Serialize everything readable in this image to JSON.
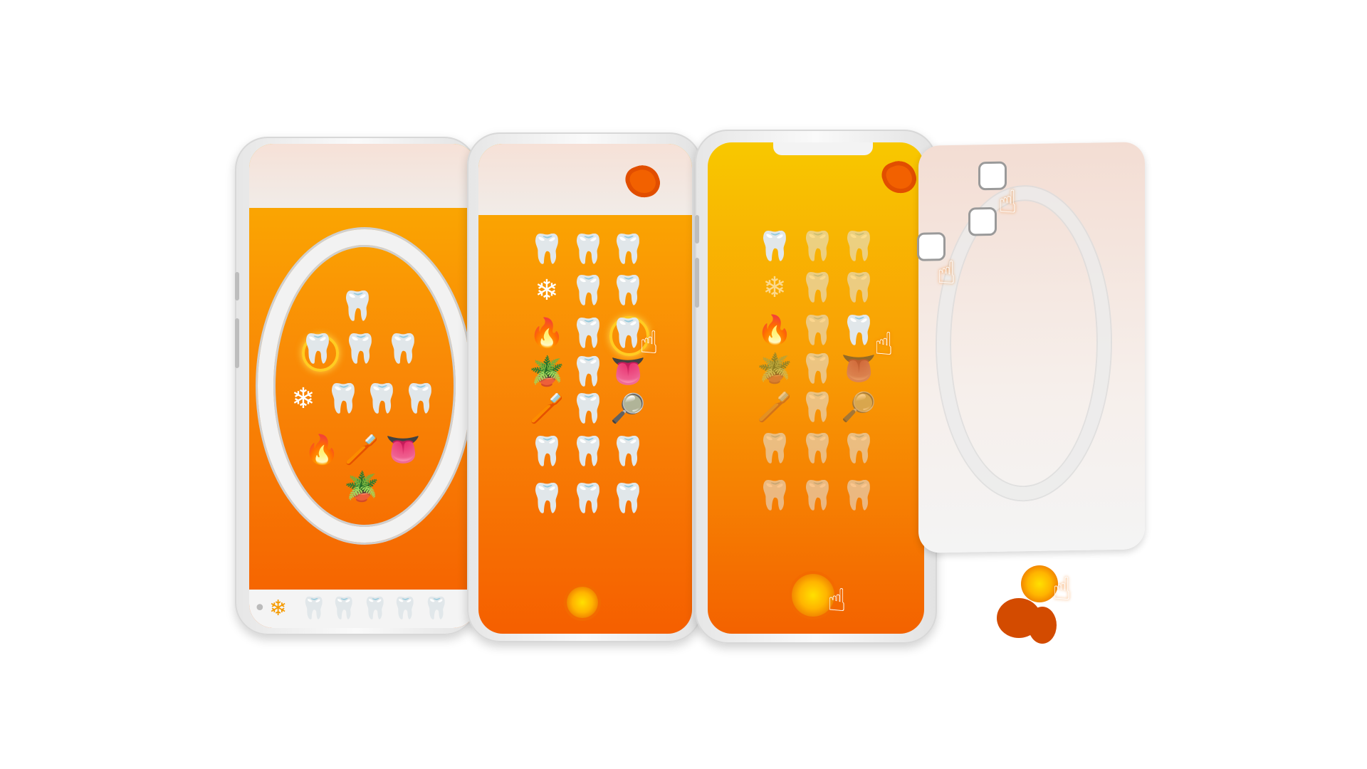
{
  "phone1": {
    "center_icons": [
      "🦷",
      "🦷",
      "🦷",
      "🦷",
      "❄",
      "🦷",
      "🦷",
      "🦷",
      "🔥",
      "🪥",
      "👅",
      "🪴"
    ],
    "bottom_icons": [
      "•",
      "❄",
      "🦷",
      "🦷",
      "🦷",
      "🦷",
      "🦷"
    ]
  },
  "phone2": {
    "grid_icons": [
      "🦷",
      "🦷",
      "🦷",
      "❄",
      "🦷",
      "🦷",
      "🔥",
      "🦷",
      "🦷",
      "🪴",
      "🦷",
      "👅",
      "🪥",
      "🦷",
      "🔎",
      "🦷",
      "🦷",
      "🦷",
      "🦷",
      "🦷",
      "🦷"
    ],
    "hand": "☝"
  },
  "phone3": {
    "grid_icons": [
      "🦷",
      "🦷",
      "🦷",
      "❄",
      "🦷",
      "🦷",
      "🔥",
      "🦷",
      "🦷",
      "🪴",
      "🦷",
      "👅",
      "🪥",
      "🦷",
      "🔎",
      "🦷",
      "🦷",
      "🦷",
      "🦷",
      "🦷",
      "🦷"
    ],
    "hand": "☝"
  },
  "card4": {
    "hand": "☝"
  },
  "colors": {
    "accent": "#f98a06",
    "accent_dark": "#f36200",
    "highlight": "#ffcc22"
  }
}
